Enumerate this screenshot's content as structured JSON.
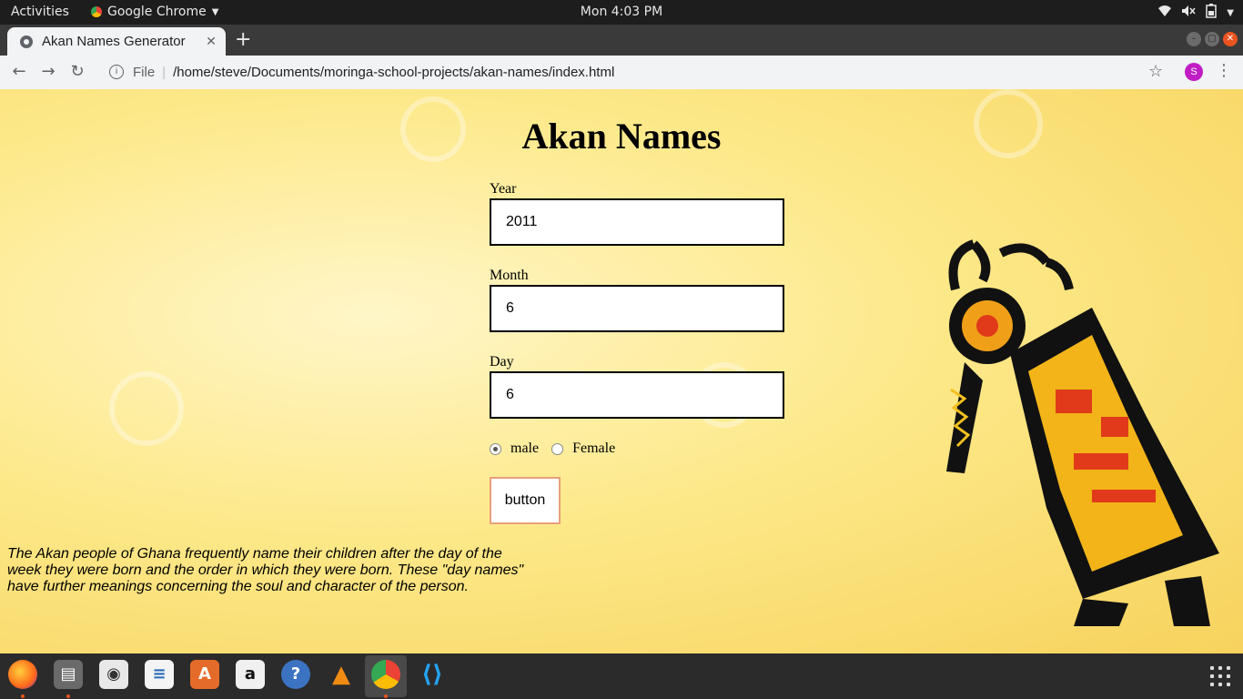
{
  "system_bar": {
    "activities": "Activities",
    "app_name": "Google Chrome",
    "clock": "Mon  4:03 PM"
  },
  "browser": {
    "tab_title": "Akan Names Generator",
    "scheme_label": "File",
    "url": "/home/steve/Documents/moringa-school-projects/akan-names/index.html",
    "profile_initial": "S"
  },
  "page": {
    "title": "Akan Names",
    "form": {
      "year_label": "Year",
      "year_value": "2011",
      "month_label": "Month",
      "month_value": "6",
      "day_label": "Day",
      "day_value": "6",
      "gender_options": [
        "male",
        "Female"
      ],
      "gender_selected": "male",
      "submit_label": "button"
    },
    "description": "The Akan people of Ghana frequently name their children after the day of the week they were born and the order in which they were born. These \"day names\" have further meanings concerning the soul and character of the person."
  },
  "dock": {
    "apps": [
      "firefox-icon",
      "files-icon",
      "rhythmbox-icon",
      "writer-icon",
      "software-icon",
      "amazon-icon",
      "help-icon",
      "vlc-icon",
      "chrome-icon",
      "vscode-icon"
    ],
    "accent": "#e95420"
  }
}
